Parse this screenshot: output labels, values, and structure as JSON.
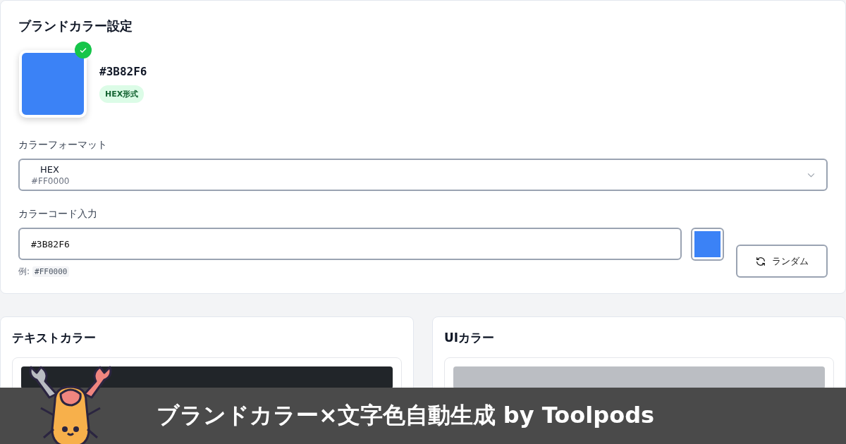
{
  "brand_settings": {
    "title": "ブランドカラー設定",
    "preview": {
      "color": "#3b82f6",
      "verified": true,
      "hex": "#3B82F6",
      "format_badge": "HEX形式"
    },
    "format_select": {
      "label": "カラーフォーマット",
      "value": "HEX",
      "sample": "#FF0000"
    },
    "code_input": {
      "label": "カラーコード入力",
      "value": "#3B82F6",
      "example_prefix": "例:",
      "example": "#FF0000"
    },
    "picker": {
      "color": "#3b82f6"
    },
    "random_button": {
      "label": "ランダム"
    }
  },
  "sections": [
    {
      "title": "テキストカラー",
      "items": [
        {
          "color": "#212529"
        }
      ]
    },
    {
      "title": "UIカラー",
      "items": [
        {
          "color": "#bbbec3"
        }
      ]
    }
  ],
  "banner": {
    "text": "ブランドカラー×文字色自動生成 by Toolpods"
  }
}
